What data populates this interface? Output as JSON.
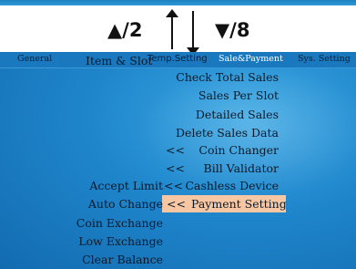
{
  "nav_hints": {
    "up": "▲/2",
    "down": "▼/8"
  },
  "tabs": [
    {
      "label": "General"
    },
    {
      "label": "Item & Slot"
    },
    {
      "label": "Temp.Setting"
    },
    {
      "label": "Sale&Payment"
    },
    {
      "label": "Sys. Setting"
    }
  ],
  "sales_menu": [
    {
      "label": "Check Total Sales"
    },
    {
      "label": "Sales Per Slot"
    },
    {
      "label": "Detailed Sales"
    },
    {
      "label": "Delete Sales Data"
    },
    {
      "label": "Coin Changer",
      "marker": "<<"
    },
    {
      "label": "Bill Validator",
      "marker": "<<"
    },
    {
      "label": "Cashless Device",
      "marker": "<<"
    },
    {
      "label": "Payment Setting",
      "marker": "<<"
    }
  ],
  "payment_submenu": [
    {
      "label": "Accept Limit"
    },
    {
      "label": "Auto Change"
    },
    {
      "label": "Coin Exchange"
    },
    {
      "label": "Low Exchange"
    },
    {
      "label": "Clear Balance"
    }
  ],
  "colors": {
    "screen_bg": "#1f86cc",
    "highlight": "#f6c7a2"
  }
}
